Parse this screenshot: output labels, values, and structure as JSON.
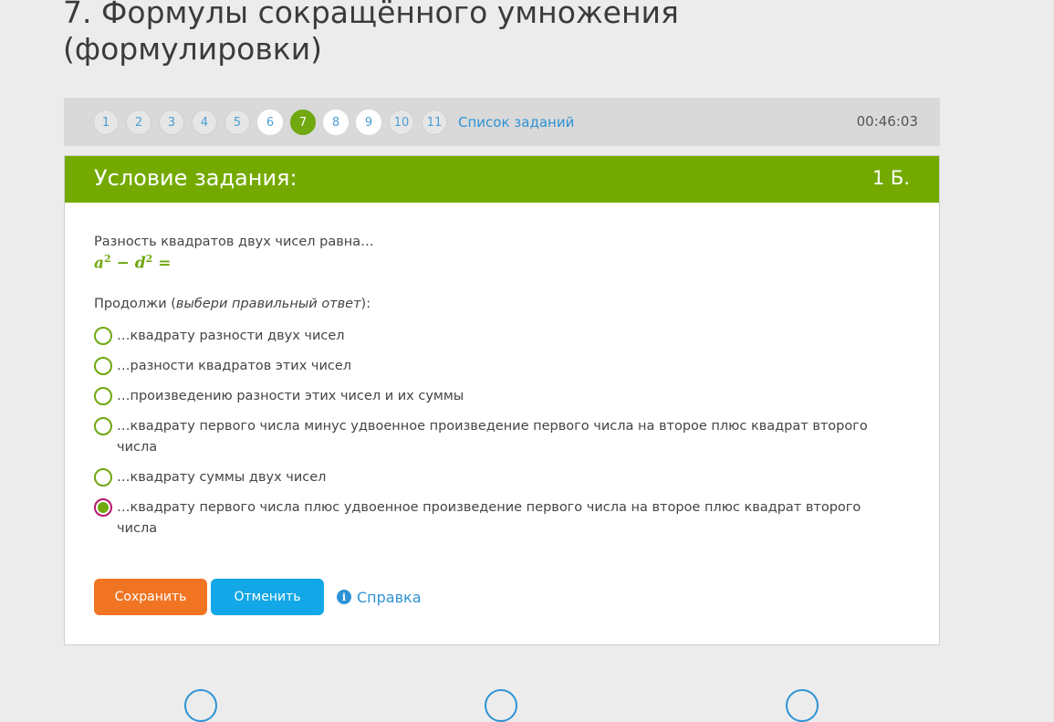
{
  "page": {
    "title": "7. Формулы сокращённого умножения (формулировки)"
  },
  "nav": {
    "pages": [
      {
        "label": "1",
        "state": "visited"
      },
      {
        "label": "2",
        "state": "visited"
      },
      {
        "label": "3",
        "state": "visited"
      },
      {
        "label": "4",
        "state": "visited"
      },
      {
        "label": "5",
        "state": "visited"
      },
      {
        "label": "6",
        "state": "done"
      },
      {
        "label": "7",
        "state": "current"
      },
      {
        "label": "8",
        "state": "done"
      },
      {
        "label": "9",
        "state": "done"
      },
      {
        "label": "10",
        "state": "visited"
      },
      {
        "label": "11",
        "state": "visited"
      }
    ],
    "task_list_label": "Список заданий",
    "timer": "00:46:03"
  },
  "card": {
    "header": "Условие задания:",
    "points": "1 Б.",
    "question": "Разность квадратов двух чисел равна…",
    "formula": {
      "a": "a",
      "exp1": "2",
      "minus": " − ",
      "d": "d",
      "exp2": "2",
      "eq": " ="
    },
    "prompt_start": "Продолжи (",
    "prompt_italic": "выбери правильный ответ",
    "prompt_end": "):",
    "options": [
      {
        "label": "…квадрату разности двух чисел",
        "checked": false
      },
      {
        "label": "…разности квадратов этих чисел",
        "checked": false
      },
      {
        "label": "…произведению разности этих чисел и их суммы",
        "checked": false
      },
      {
        "label": "…квадрату первого числа минус удвоенное произведение первого числа на второе плюс квадрат второго числа",
        "checked": false
      },
      {
        "label": "…квадрату суммы двух чисел",
        "checked": false
      },
      {
        "label": "…квадрату первого числа плюс удвоенное произведение первого числа на второе плюс квадрат второго числа",
        "checked": true
      }
    ],
    "buttons": {
      "save": "Сохранить",
      "cancel": "Отменить",
      "help": "Справка"
    }
  },
  "colors": {
    "accent": "#74aa00",
    "save": "#f07422",
    "cancel": "#12a7e6",
    "link": "#2e93d4"
  }
}
